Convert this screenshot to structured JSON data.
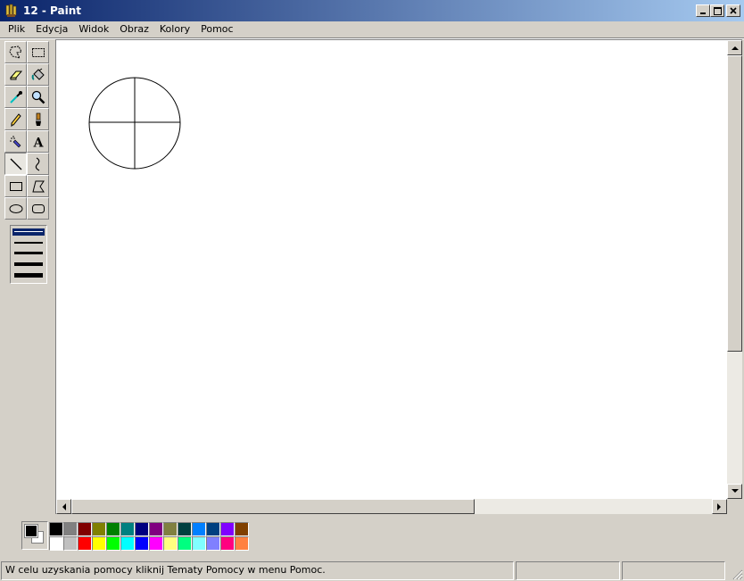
{
  "window": {
    "title": "12 - Paint",
    "icon": "paint-brush-icon",
    "controls": {
      "minimize": "minimize-icon",
      "maximize": "maximize-icon",
      "close": "close-icon"
    }
  },
  "menu": [
    "Plik",
    "Edycja",
    "Widok",
    "Obraz",
    "Kolory",
    "Pomoc"
  ],
  "tools": [
    {
      "name": "free-form-select",
      "icon": "free-form-select-icon"
    },
    {
      "name": "select",
      "icon": "rect-select-icon"
    },
    {
      "name": "eraser",
      "icon": "eraser-icon"
    },
    {
      "name": "fill",
      "icon": "fill-bucket-icon"
    },
    {
      "name": "pick-color",
      "icon": "eyedropper-icon"
    },
    {
      "name": "magnifier",
      "icon": "magnifier-icon"
    },
    {
      "name": "pencil",
      "icon": "pencil-icon"
    },
    {
      "name": "brush",
      "icon": "brush-icon"
    },
    {
      "name": "airbrush",
      "icon": "airbrush-icon"
    },
    {
      "name": "text",
      "icon": "text-icon",
      "glyph": "A"
    },
    {
      "name": "line",
      "icon": "line-icon",
      "active": true
    },
    {
      "name": "curve",
      "icon": "curve-icon"
    },
    {
      "name": "rectangle",
      "icon": "rectangle-icon"
    },
    {
      "name": "polygon",
      "icon": "polygon-icon"
    },
    {
      "name": "ellipse",
      "icon": "ellipse-icon"
    },
    {
      "name": "rounded-rectangle",
      "icon": "rounded-rectangle-icon"
    }
  ],
  "line_widths": {
    "count": 5,
    "selected_index": 0
  },
  "colors": {
    "foreground": "#000000",
    "background": "#ffffff",
    "title_gradient_start": "#0a246a",
    "title_gradient_end": "#a6caf0",
    "palette_row1": [
      "#000000",
      "#808080",
      "#800000",
      "#808000",
      "#008000",
      "#008080",
      "#000080",
      "#800080",
      "#808040",
      "#004040",
      "#0080ff",
      "#004080",
      "#8000ff",
      "#804000"
    ],
    "palette_row2": [
      "#ffffff",
      "#c0c0c0",
      "#ff0000",
      "#ffff00",
      "#00ff00",
      "#00ffff",
      "#0000ff",
      "#ff00ff",
      "#ffff80",
      "#00ff80",
      "#80ffff",
      "#8080ff",
      "#ff0080",
      "#ff8040"
    ]
  },
  "drawing": {
    "shape": "circle with vertical and horizontal cross lines"
  },
  "status": {
    "help_text": "W celu uzyskania pomocy kliknij Tematy Pomocy w menu Pomoc.",
    "coords": "",
    "size": ""
  }
}
